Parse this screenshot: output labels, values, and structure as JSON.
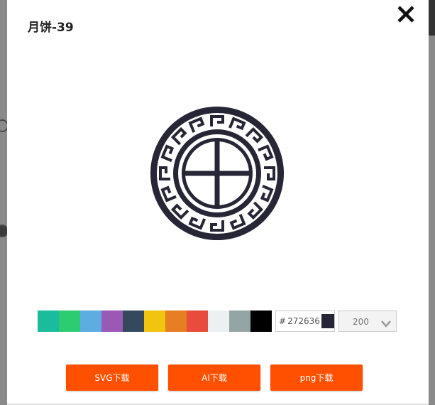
{
  "dialog": {
    "title": "月饼-39",
    "close_label": "close"
  },
  "icon": {
    "name": "mooncake-pattern-icon",
    "color": "#272636"
  },
  "palette": {
    "swatches": [
      {
        "name": "turquoise",
        "color": "#1abc9c"
      },
      {
        "name": "emerald",
        "color": "#2ecc71"
      },
      {
        "name": "peter-river",
        "color": "#5dade2"
      },
      {
        "name": "amethyst",
        "color": "#9b59b6"
      },
      {
        "name": "wet-asphalt",
        "color": "#34495e"
      },
      {
        "name": "sunflower",
        "color": "#f1c40f"
      },
      {
        "name": "carrot",
        "color": "#e67e22"
      },
      {
        "name": "alizarin",
        "color": "#e74c3c"
      },
      {
        "name": "clouds",
        "color": "#ecf0f1"
      },
      {
        "name": "concrete",
        "color": "#95a5a6"
      },
      {
        "name": "black",
        "color": "#000000"
      }
    ],
    "hex_prefix": "#",
    "hex_value": "272636",
    "current_color": "#272636"
  },
  "size": {
    "value": "200"
  },
  "buttons": {
    "svg": "SVG下载",
    "ai": "AI下载",
    "png": "png下载",
    "accent": "#ff5000"
  }
}
